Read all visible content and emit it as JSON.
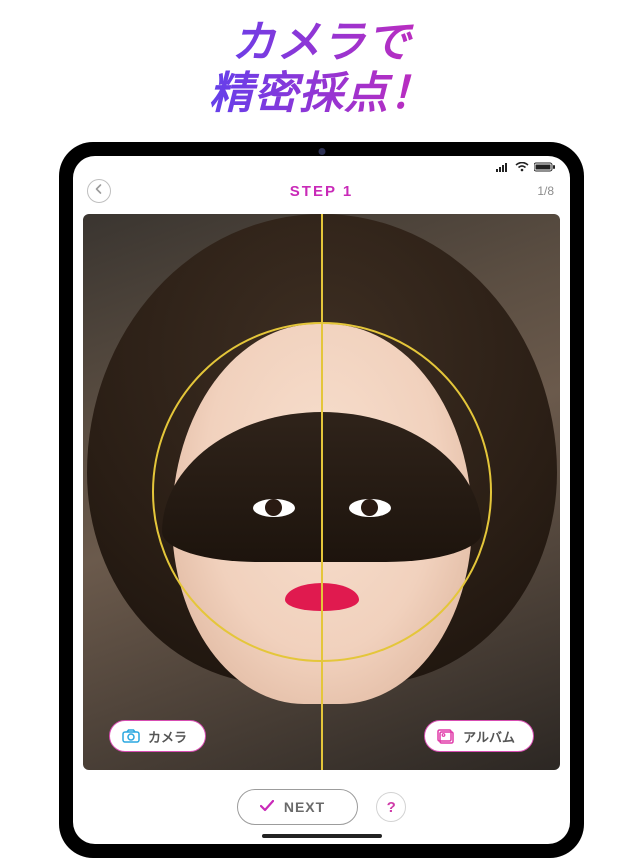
{
  "promo": {
    "line1": "カメラで",
    "line2": "精密採点！"
  },
  "header": {
    "step_label": "STEP 1",
    "page_indicator": "1/8"
  },
  "photo_buttons": {
    "camera_label": "カメラ",
    "album_label": "アルバム"
  },
  "footer": {
    "next_label": "NEXT",
    "help_label": "?"
  },
  "icons": {
    "back": "back-arrow-icon",
    "camera": "camera-icon",
    "album": "album-icon",
    "check": "check-icon",
    "help": "help-icon",
    "signal": "signal-icon",
    "wifi": "wifi-icon",
    "battery": "battery-icon"
  },
  "colors": {
    "accent_pink": "#d84db3",
    "accent_magenta": "#c92ab8",
    "guide_yellow": "#e4c63a"
  }
}
